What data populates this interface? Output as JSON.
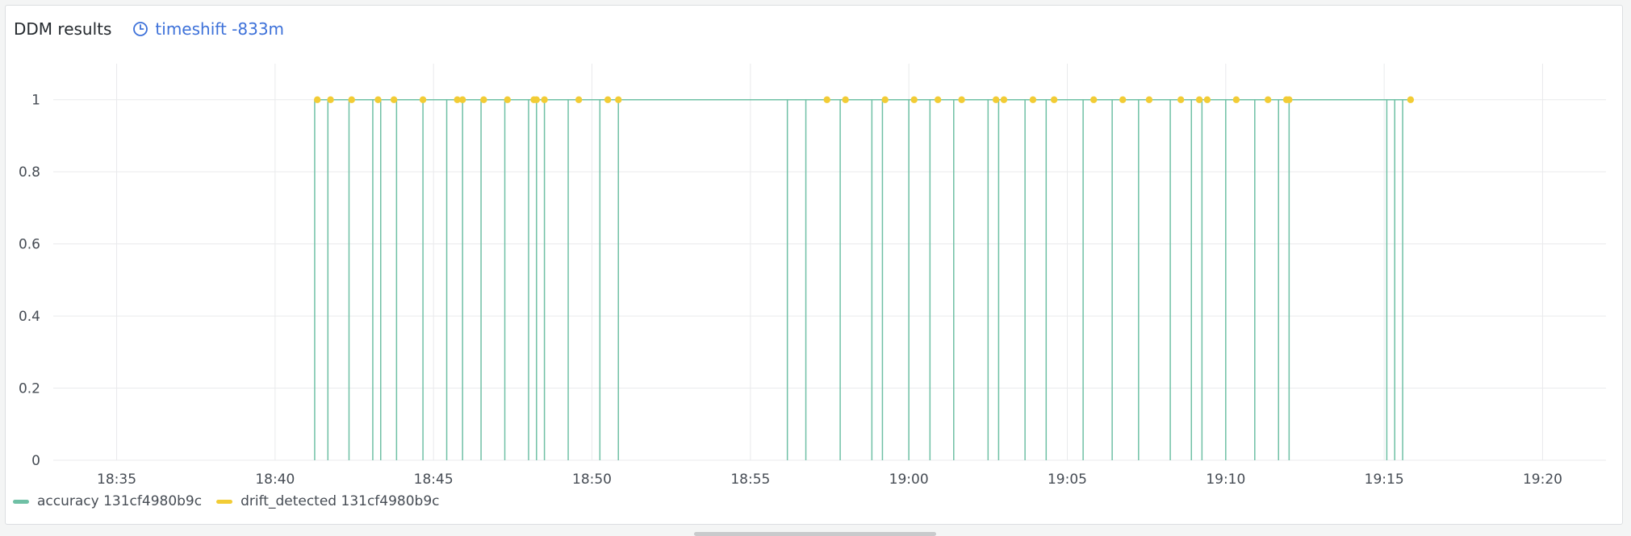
{
  "panel": {
    "title": "DDM results",
    "timeshift_label": "timeshift -833m"
  },
  "chart_data": {
    "type": "line",
    "title": "DDM results",
    "x_ticks": [
      "18:35",
      "18:40",
      "18:45",
      "18:50",
      "18:55",
      "19:00",
      "19:05",
      "19:10",
      "19:15",
      "19:20"
    ],
    "xlim": [
      "18:33",
      "19:22"
    ],
    "y_ticks": [
      "0",
      "0.2",
      "0.4",
      "0.6",
      "0.8",
      "1"
    ],
    "ylim": [
      0,
      1.1
    ],
    "grid": true,
    "legend_position": "bottom-left",
    "series": [
      {
        "name": "accuracy 131cf4980b9c",
        "color": "#6fc0a5",
        "style": "step",
        "value_high": 1,
        "value_low": 0,
        "drop_times": [
          "18:41:15",
          "18:41:40",
          "18:42:20",
          "18:43:05",
          "18:43:20",
          "18:43:50",
          "18:44:40",
          "18:45:25",
          "18:45:55",
          "18:46:30",
          "18:47:15",
          "18:48:00",
          "18:48:15",
          "18:48:30",
          "18:49:15",
          "18:50:15",
          "18:50:50",
          "18:56:10",
          "18:56:45",
          "18:57:50",
          "18:58:50",
          "18:59:10",
          "19:00:00",
          "19:00:40",
          "19:01:25",
          "19:02:30",
          "19:02:50",
          "19:03:40",
          "19:04:20",
          "19:05:30",
          "19:06:25",
          "19:07:15",
          "19:08:15",
          "19:08:55",
          "19:09:15",
          "19:10:00",
          "19:10:55",
          "19:11:40",
          "19:12:00",
          "19:15:05",
          "19:15:20",
          "19:15:35"
        ]
      },
      {
        "name": "drift_detected 131cf4980b9c",
        "color": "#f2cc35",
        "style": "points",
        "value": 1,
        "times": [
          "18:41:20",
          "18:41:45",
          "18:42:25",
          "18:43:15",
          "18:43:45",
          "18:44:40",
          "18:45:45",
          "18:45:55",
          "18:46:35",
          "18:47:20",
          "18:48:10",
          "18:48:15",
          "18:48:30",
          "18:49:35",
          "18:50:30",
          "18:50:50",
          "18:57:25",
          "18:58:00",
          "18:59:15",
          "19:00:10",
          "19:00:55",
          "19:01:40",
          "19:02:45",
          "19:03:00",
          "19:03:55",
          "19:04:35",
          "19:05:50",
          "19:06:45",
          "19:07:35",
          "19:08:35",
          "19:09:10",
          "19:09:25",
          "19:10:20",
          "19:11:20",
          "19:11:55",
          "19:12:00",
          "19:15:50"
        ]
      }
    ]
  }
}
